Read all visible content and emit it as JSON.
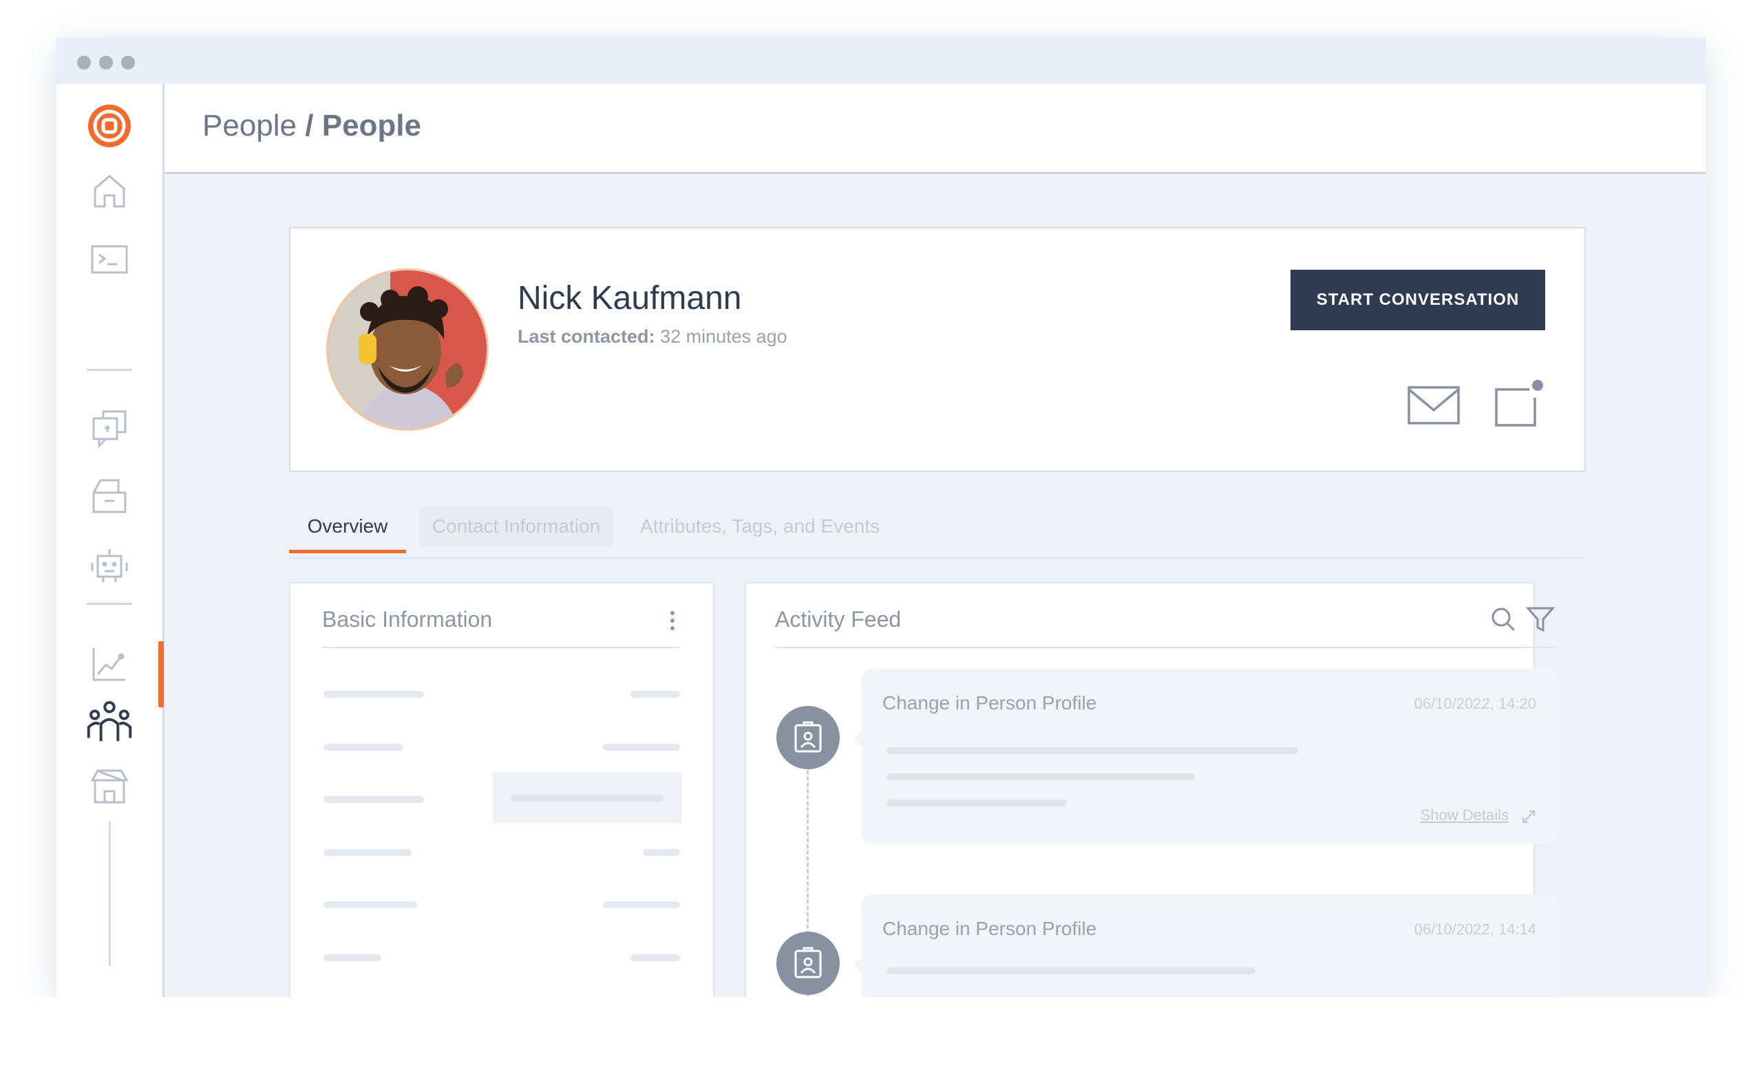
{
  "window": {
    "controls": [
      "close",
      "minimize",
      "maximize"
    ]
  },
  "sidebar": {
    "logo": "brand-logo",
    "items": [
      {
        "name": "home",
        "icon": "home-icon"
      },
      {
        "name": "terminal",
        "icon": "terminal-icon"
      },
      {
        "name": "conversations",
        "icon": "chat-icon"
      },
      {
        "name": "inbox",
        "icon": "inbox-icon"
      },
      {
        "name": "bots",
        "icon": "robot-icon"
      },
      {
        "name": "analytics",
        "icon": "chart-icon"
      },
      {
        "name": "people",
        "icon": "people-icon",
        "active": true
      },
      {
        "name": "store",
        "icon": "store-icon"
      }
    ]
  },
  "breadcrumb": {
    "root": "People",
    "separator": "/",
    "current": "People"
  },
  "profile": {
    "name": "Nick Kaufmann",
    "last_contacted_label": "Last contacted:",
    "last_contacted_value": "32 minutes ago",
    "start_button": "START CONVERSATION",
    "actions": [
      "mail-icon",
      "note-icon"
    ]
  },
  "tabs": [
    {
      "label": "Overview",
      "active": true
    },
    {
      "label": "Contact Information"
    },
    {
      "label": "Attributes, Tags, and Events"
    }
  ],
  "basic_info": {
    "title": "Basic Information"
  },
  "activity_feed": {
    "title": "Activity Feed",
    "entries": [
      {
        "title": "Change in Person Profile",
        "date": "06/10/2022, 14:20",
        "link": "Show Details"
      },
      {
        "title": "Change in Person Profile",
        "date": "06/10/2022, 14:14"
      }
    ]
  },
  "colors": {
    "accent": "#f06b2c",
    "button": "#2f3b50",
    "background": "#eef2f8"
  }
}
